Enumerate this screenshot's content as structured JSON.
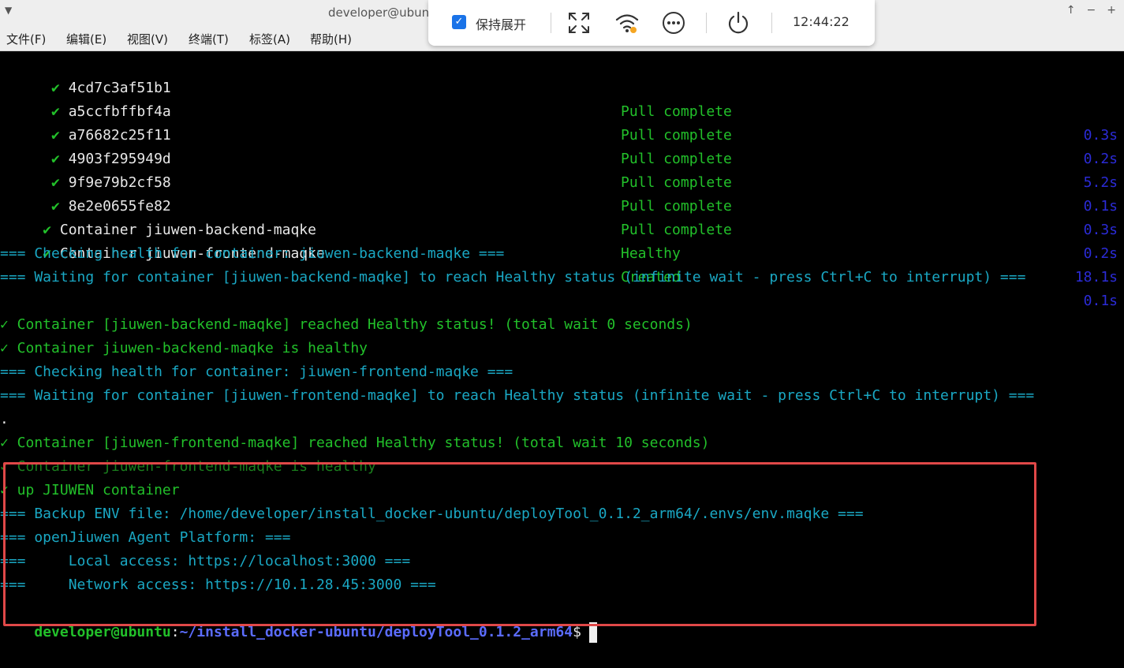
{
  "window": {
    "title": "developer@ubuntu",
    "buttons": [
      "↑",
      "−",
      "+"
    ]
  },
  "menu": [
    "文件(F)",
    "编辑(E)",
    "视图(V)",
    "终端(T)",
    "标签(A)",
    "帮助(H)"
  ],
  "remote_bar": {
    "keep_expanded_label": "保持展开",
    "keep_expanded_checked": true,
    "time": "12:44:22",
    "icons": [
      "fullscreen-icon",
      "wifi-icon",
      "more-icon",
      "power-icon"
    ]
  },
  "terminal": {
    "pull_rows": [
      {
        "id": "4cd7c3af51b1",
        "status": "Pull complete",
        "time": "0.3s"
      },
      {
        "id": "a5ccfbffbf4a",
        "status": "Pull complete",
        "time": "0.2s"
      },
      {
        "id": "a76682c25f11",
        "status": "Pull complete",
        "time": "5.2s"
      },
      {
        "id": "4903f295949d",
        "status": "Pull complete",
        "time": "0.1s"
      },
      {
        "id": "9f9e79b2cf58",
        "status": "Pull complete",
        "time": "0.3s"
      },
      {
        "id": "8e2e0655fe82",
        "status": "Pull complete",
        "time": "0.2s"
      }
    ],
    "container_rows": [
      {
        "name": "Container jiuwen-backend-maqke",
        "status": "Healthy",
        "time": "18.1s"
      },
      {
        "name": "Container jiuwen-frontend-maqke",
        "status": "Created",
        "time": "0.1s"
      }
    ],
    "log_lines": [
      {
        "text": "=== Checking health for container: jiuwen-backend-maqke ===",
        "color": "cy"
      },
      {
        "text": "=== Waiting for container [jiuwen-backend-maqke] to reach Healthy status (infinite wait - press Ctrl+C to interrupt) ===",
        "color": "cy"
      },
      {
        "text": "",
        "color": "cy"
      },
      {
        "text": "✓ Container [jiuwen-backend-maqke] reached Healthy status! (total wait 0 seconds)",
        "color": "g"
      },
      {
        "text": "✓ Container jiuwen-backend-maqke is healthy",
        "color": "g"
      },
      {
        "text": "=== Checking health for container: jiuwen-frontend-maqke ===",
        "color": "cy"
      },
      {
        "text": "=== Waiting for container [jiuwen-frontend-maqke] to reach Healthy status (infinite wait - press Ctrl+C to interrupt) ===",
        "color": "cy"
      },
      {
        "text": ".",
        "color": "wh"
      },
      {
        "text": "✓ Container [jiuwen-frontend-maqke] reached Healthy status! (total wait 10 seconds)",
        "color": "g"
      },
      {
        "text": "✓ Container jiuwen-frontend-maqke is healthy",
        "color": "g"
      },
      {
        "text": "✓ up JIUWEN container",
        "color": "g"
      },
      {
        "text": "=== Backup ENV file: /home/developer/install_docker-ubuntu/deployTool_0.1.2_arm64/.envs/env.maqke ===",
        "color": "cy"
      },
      {
        "text": "=== openJiuwen Agent Platform: ===",
        "color": "cy"
      },
      {
        "text": "===     Local access: https://localhost:3000 ===",
        "color": "cy"
      },
      {
        "text": "===     Network access: https://10.1.28.45:3000 ===",
        "color": "cy"
      }
    ],
    "prompt": {
      "user": "developer@ubuntu",
      "sep": ":",
      "path": "~/install_docker-ubuntu/deployTool_0.1.2_arm64",
      "symbol": "$"
    }
  },
  "colors": {
    "highlight_box": "#e04848",
    "green": "#22c02a",
    "cyan": "#1aa8c4",
    "blue_time": "#2b2bd6"
  }
}
